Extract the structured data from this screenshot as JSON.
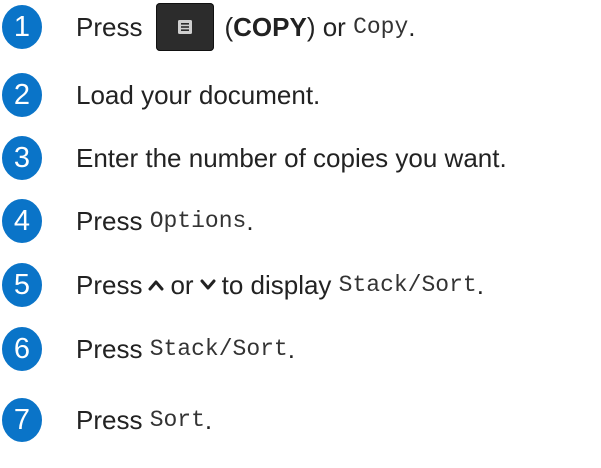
{
  "accent_color": "#0a74c8",
  "steps": [
    {
      "number": "1",
      "press": "Press",
      "button_icon": "copy-document-icon",
      "open_paren": "(",
      "copy_label": "COPY",
      "close_or": ") or",
      "copy_mono": "Copy",
      "end": "."
    },
    {
      "number": "2",
      "text": "Load your document."
    },
    {
      "number": "3",
      "text": "Enter the number of copies you want."
    },
    {
      "number": "4",
      "press": "Press",
      "mono": "Options",
      "end": "."
    },
    {
      "number": "5",
      "press": "Press",
      "up_icon": "chevron-up-icon",
      "or": "or",
      "down_icon": "chevron-down-icon",
      "to_display": "to display",
      "mono": "Stack/Sort",
      "end": "."
    },
    {
      "number": "6",
      "press": "Press",
      "mono": "Stack/Sort",
      "end": "."
    },
    {
      "number": "7",
      "press": "Press",
      "mono": "Sort",
      "end": "."
    }
  ]
}
